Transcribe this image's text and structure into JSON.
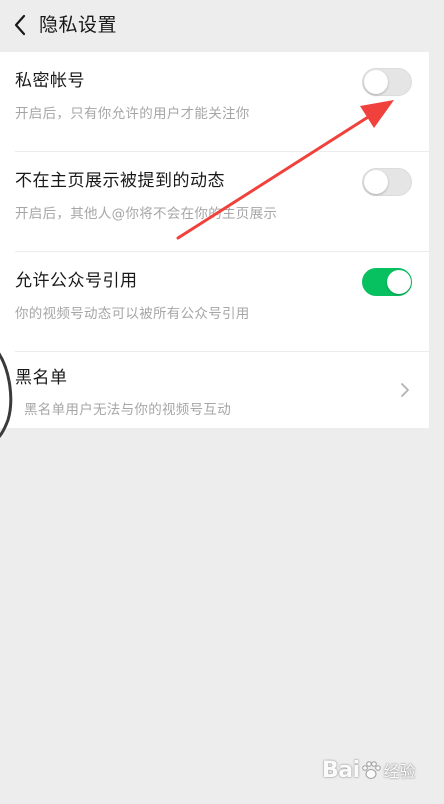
{
  "header": {
    "title": "隐私设置",
    "back_icon": "chevron-left-icon"
  },
  "settings": [
    {
      "title": "私密帐号",
      "subtitle": "开启后，只有你允许的用户才能关注你",
      "control": "toggle",
      "enabled": false
    },
    {
      "title": "不在主页展示被提到的动态",
      "subtitle": "开启后，其他人@你将不会在你的主页展示",
      "control": "toggle",
      "enabled": false
    },
    {
      "title": "允许公众号引用",
      "subtitle": "你的视频号动态可以被所有公众号引用",
      "control": "toggle",
      "enabled": true
    },
    {
      "title": "黑名单",
      "subtitle": "黑名单用户无法与你的视频号互动",
      "control": "chevron",
      "icon": "chevron-right-icon"
    }
  ],
  "watermark": {
    "brand": "Bai",
    "brand_suffix": "经验"
  },
  "colors": {
    "background": "#ededed",
    "card": "#ffffff",
    "toggle_on": "#07c160",
    "toggle_off": "#e5e5e5",
    "annotation_arrow": "#f0413c"
  }
}
